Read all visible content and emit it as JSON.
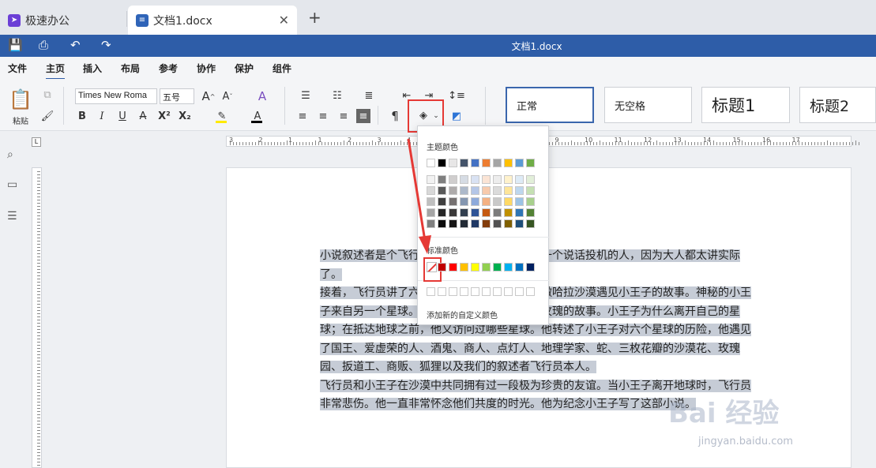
{
  "tabs": [
    {
      "label": "极速办公",
      "icon": "rocket-icon"
    },
    {
      "label": "文档1.docx",
      "icon": "document-icon"
    }
  ],
  "titlebar": {
    "title": "文档1.docx"
  },
  "menu": [
    "文件",
    "主页",
    "插入",
    "布局",
    "参考",
    "协作",
    "保护",
    "组件"
  ],
  "ribbon": {
    "paste_label": "粘贴",
    "font_name": "Times New Roma",
    "font_size": "五号",
    "styles": [
      "正常",
      "无空格",
      "标题1",
      "标题2"
    ]
  },
  "ruler": {
    "numbers": [
      "3",
      "2",
      "1",
      "1",
      "2",
      "3",
      "4",
      "5",
      "6",
      "7",
      "8",
      "9",
      "10",
      "11",
      "12",
      "13",
      "14",
      "15",
      "16",
      "17"
    ]
  },
  "color_popup": {
    "theme_title": "主题颜色",
    "standard_title": "标准颜色",
    "custom_label": "添加新的自定义颜色",
    "theme_top_row": [
      "#ffffff",
      "#000000",
      "#e7e6e6",
      "#44546a",
      "#4472c4",
      "#ed7d31",
      "#a5a5a5",
      "#ffc000",
      "#5b9bd5",
      "#70ad47"
    ],
    "theme_shades": [
      [
        "#f2f2f2",
        "#7f7f7f",
        "#d0cece",
        "#d6dce4",
        "#d9e2f3",
        "#fbe4d5",
        "#ededed",
        "#fff2cc",
        "#deebf6",
        "#e2efd9"
      ],
      [
        "#d8d8d8",
        "#595959",
        "#aeabab",
        "#adb9ca",
        "#b4c6e7",
        "#f7caac",
        "#dbdbdb",
        "#fee599",
        "#bdd7ee",
        "#c5e0b3"
      ],
      [
        "#bfbfbf",
        "#3f3f3f",
        "#757070",
        "#8496b0",
        "#8eaadb",
        "#f4b183",
        "#c9c9c9",
        "#ffd965",
        "#9cc3e5",
        "#a8d08d"
      ],
      [
        "#a5a5a5",
        "#262626",
        "#3a3838",
        "#323f4f",
        "#2f5496",
        "#c55a11",
        "#7b7b7b",
        "#bf9000",
        "#2e75b5",
        "#538135"
      ],
      [
        "#7f7f7f",
        "#0c0c0c",
        "#171616",
        "#222a35",
        "#1f3864",
        "#833c0b",
        "#525252",
        "#7f6000",
        "#1e4e79",
        "#375623"
      ]
    ],
    "standard_colors": [
      "#c00000",
      "#ff0000",
      "#ffc000",
      "#ffff00",
      "#92d050",
      "#00b050",
      "#00b0f0",
      "#0070c0",
      "#002060"
    ]
  },
  "document": {
    "paragraphs": [
      "小说叙述者是个飞行员，他在大人世界找不到一个说话投机的人，因为大人都太讲实际了。",
      "接着，飞行员讲了六年前他因飞机故障迫降在撒哈拉沙漠遇见小王子的故事。神秘的小王子来自另一个星球。飞行员讲了小王子和他的玫瑰的故事。小王子为什么离开自己的星球；在抵达地球之前，他又访问过哪些星球。他转述了小王子对六个星球的历险，他遇见了国王、爱虚荣的人、酒鬼、商人、点灯人、地理学家、蛇、三枚花瓣的沙漠花、玫瑰园、扳道工、商贩、狐狸以及我们的叙述者飞行员本人。",
      "飞行员和小王子在沙漠中共同拥有过一段极为珍贵的友谊。当小王子离开地球时，飞行员非常悲伤。他一直非常怀念他们共度的时光。他为纪念小王子写了这部小说。"
    ]
  },
  "watermark": {
    "text": "Bai 经验",
    "url": "jingyan.baidu.com"
  }
}
